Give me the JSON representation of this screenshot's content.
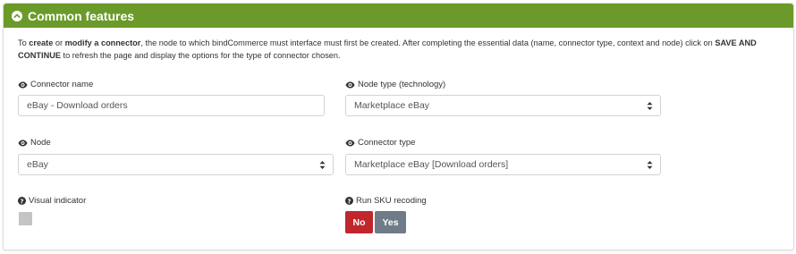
{
  "panel": {
    "title": "Common features",
    "header_color": "#6b9a2a"
  },
  "intro": {
    "t1": "To ",
    "b1": "create",
    "t2": " or ",
    "b2": "modify a connector",
    "t3": ", the node to which bindCommerce must interface must first be created. After completing the essential data (name, connector type, context and node) click on ",
    "b3": "SAVE AND CONTINUE",
    "t4": " to refresh the page and display the options for the type of connector chosen."
  },
  "fields": {
    "connector_name": {
      "label": "Connector name",
      "value": "eBay - Download orders",
      "icon": "eye-icon"
    },
    "node_type": {
      "label": "Node type (technology)",
      "value": "Marketplace eBay",
      "icon": "eye-icon"
    },
    "node": {
      "label": "Node",
      "value": "eBay",
      "icon": "eye-icon"
    },
    "connector_type": {
      "label": "Connector type",
      "value": "Marketplace eBay [Download orders]",
      "icon": "eye-icon"
    },
    "visual_indicator": {
      "label": "Visual indicator",
      "icon": "question-circle-icon",
      "color": "#c4c4c4"
    },
    "run_sku": {
      "label": "Run SKU recoding",
      "icon": "question-circle-icon",
      "no_label": "No",
      "yes_label": "Yes",
      "selected": "No",
      "no_color": "#c0272d",
      "yes_color": "#6f7b87"
    }
  }
}
